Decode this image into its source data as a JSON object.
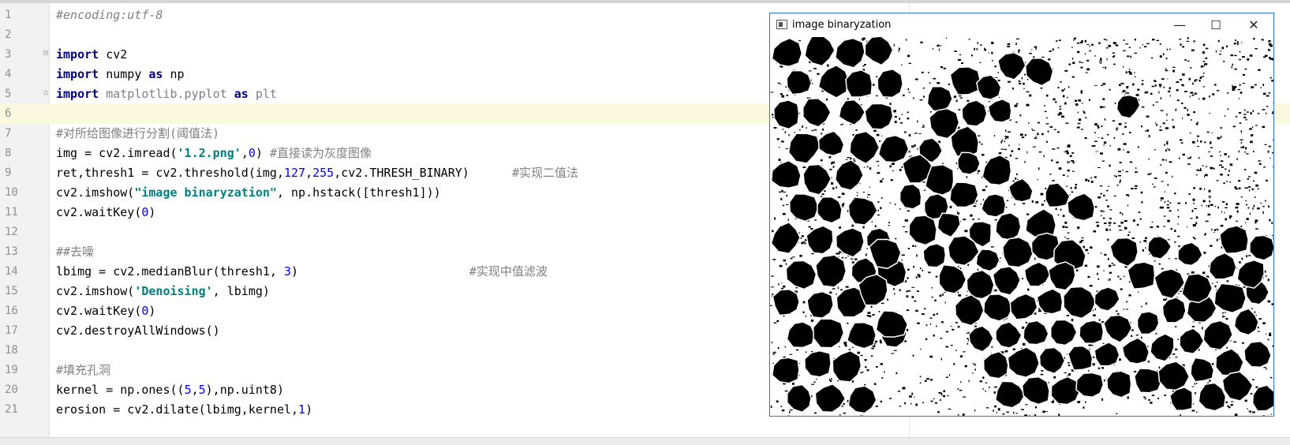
{
  "editor": {
    "lines": [
      {
        "n": "1",
        "segs": [
          [
            "#encoding:utf-8",
            "cmt"
          ]
        ]
      },
      {
        "n": "2",
        "segs": []
      },
      {
        "n": "3",
        "segs": [
          [
            "import",
            "kw"
          ],
          [
            " cv2",
            ""
          ]
        ]
      },
      {
        "n": "4",
        "segs": [
          [
            "import",
            "kw"
          ],
          [
            " numpy ",
            ""
          ],
          [
            "as",
            "kw"
          ],
          [
            " np",
            ""
          ]
        ]
      },
      {
        "n": "5",
        "segs": [
          [
            "import",
            "kw"
          ],
          [
            " matplotlib.pyplot ",
            "dim"
          ],
          [
            "as",
            "kw"
          ],
          [
            " plt",
            "dim"
          ]
        ]
      },
      {
        "n": "6",
        "segs": []
      },
      {
        "n": "7",
        "segs": [
          [
            "#对所给图像进行分割(阈值法)",
            "cmtp"
          ]
        ]
      },
      {
        "n": "8",
        "segs": [
          [
            "img = cv2.imread(",
            ""
          ],
          [
            "'1.2.png'",
            "str"
          ],
          [
            ",",
            ""
          ],
          [
            "0",
            "num"
          ],
          [
            ") ",
            ""
          ],
          [
            "#直接读为灰度图像",
            "cmtp"
          ]
        ]
      },
      {
        "n": "9",
        "segs": [
          [
            "ret,thresh1 = cv2.threshold(img,",
            ""
          ],
          [
            "127",
            "num"
          ],
          [
            ",",
            ""
          ],
          [
            "255",
            "num"
          ],
          [
            ",cv2.THRESH_BINARY)      ",
            ""
          ],
          [
            "#实现二值法",
            "cmtp"
          ]
        ]
      },
      {
        "n": "10",
        "segs": [
          [
            "cv2.imshow(",
            ""
          ],
          [
            "\"image binaryzation\"",
            "str"
          ],
          [
            ", np.hstack([thresh1]))",
            ""
          ]
        ]
      },
      {
        "n": "11",
        "segs": [
          [
            "cv2.waitKey(",
            ""
          ],
          [
            "0",
            "num"
          ],
          [
            ")",
            ""
          ]
        ]
      },
      {
        "n": "12",
        "segs": []
      },
      {
        "n": "13",
        "segs": [
          [
            "##去噪",
            "cmtp"
          ]
        ]
      },
      {
        "n": "14",
        "segs": [
          [
            "lbimg = cv2.medianBlur(thresh1, ",
            ""
          ],
          [
            "3",
            "num"
          ],
          [
            ")                        ",
            ""
          ],
          [
            "#实现中值滤波",
            "cmtp"
          ]
        ]
      },
      {
        "n": "15",
        "segs": [
          [
            "cv2.imshow(",
            ""
          ],
          [
            "'Denoising'",
            "str"
          ],
          [
            ", lbimg)",
            ""
          ]
        ]
      },
      {
        "n": "16",
        "segs": [
          [
            "cv2.waitKey(",
            ""
          ],
          [
            "0",
            "num"
          ],
          [
            ")",
            ""
          ]
        ]
      },
      {
        "n": "17",
        "segs": [
          [
            "cv2.destroyAllWindows()",
            ""
          ]
        ]
      },
      {
        "n": "18",
        "segs": []
      },
      {
        "n": "19",
        "segs": [
          [
            "#填充孔洞",
            "cmtp"
          ]
        ]
      },
      {
        "n": "20",
        "segs": [
          [
            "kernel = np.ones((",
            ""
          ],
          [
            "5",
            "num"
          ],
          [
            ",",
            ""
          ],
          [
            "5",
            "num"
          ],
          [
            "),np.uint8)",
            ""
          ]
        ]
      },
      {
        "n": "21",
        "segs": [
          [
            "erosion = cv2.dilate(lbimg,kernel,",
            ""
          ],
          [
            "1",
            "num"
          ],
          [
            ")",
            ""
          ]
        ]
      }
    ],
    "current_line": "6"
  },
  "image_window": {
    "title": "image binaryzation",
    "minimize": "—",
    "maximize": "☐",
    "close": "✕",
    "icon": "app-window-icon"
  }
}
